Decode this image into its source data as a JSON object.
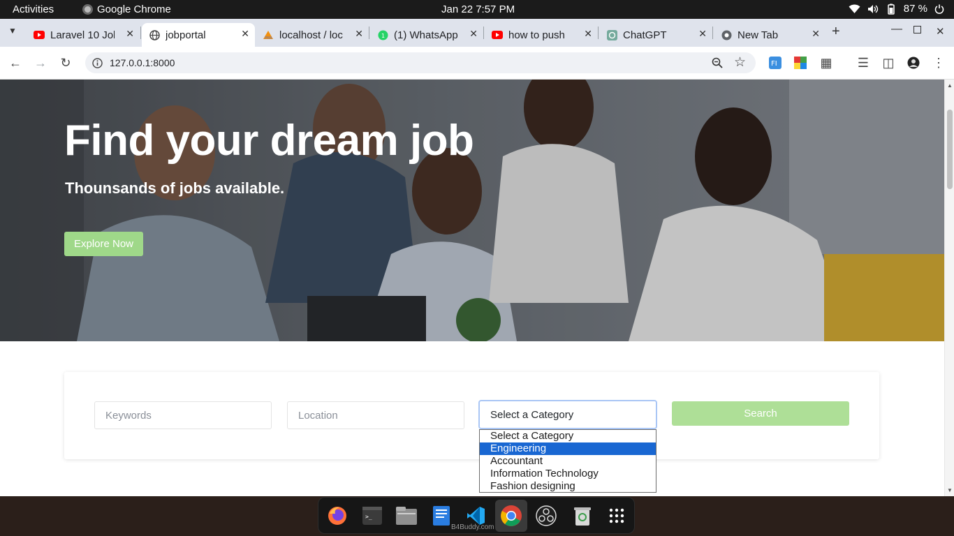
{
  "system_bar": {
    "activities": "Activities",
    "app_name": "Google Chrome",
    "clock": "Jan 22  7:57 PM",
    "battery": "87 %"
  },
  "tabs": [
    {
      "title": "Laravel 10 Jol",
      "icon": "youtube-icon",
      "active": false
    },
    {
      "title": "jobportal",
      "icon": "globe-icon",
      "active": true
    },
    {
      "title": "localhost / loc",
      "icon": "phpmyadmin-icon",
      "active": false
    },
    {
      "title": "(1) WhatsApp",
      "icon": "whatsapp-icon",
      "active": false
    },
    {
      "title": "how to push",
      "icon": "youtube-icon",
      "active": false
    },
    {
      "title": "ChatGPT",
      "icon": "chatgpt-icon",
      "active": false
    },
    {
      "title": "New Tab",
      "icon": "chrome-icon",
      "active": false
    }
  ],
  "address_bar": {
    "url": "127.0.0.1:8000"
  },
  "hero": {
    "title": "Find your dream job",
    "subtitle": "Thounsands of jobs available.",
    "cta_label": "Explore Now"
  },
  "search": {
    "keywords_placeholder": "Keywords",
    "location_placeholder": "Location",
    "category_selected": "Select a Category",
    "button_label": "Search",
    "category_options": [
      {
        "label": "Select a Category",
        "highlighted": false
      },
      {
        "label": "Engineering",
        "highlighted": true
      },
      {
        "label": "Accountant",
        "highlighted": false
      },
      {
        "label": "Information Technology",
        "highlighted": false
      },
      {
        "label": "Fashion designing",
        "highlighted": false
      }
    ]
  },
  "dock": {
    "apps": [
      "firefox-icon",
      "terminal-icon",
      "files-icon",
      "text-editor-icon",
      "vscode-icon",
      "chrome-icon",
      "obs-icon",
      "trash-icon",
      "app-grid-icon"
    ],
    "watermark": "B4Buddy.com"
  },
  "colors": {
    "accent_green": "#9fd889",
    "selected_option": "#1967d2"
  }
}
